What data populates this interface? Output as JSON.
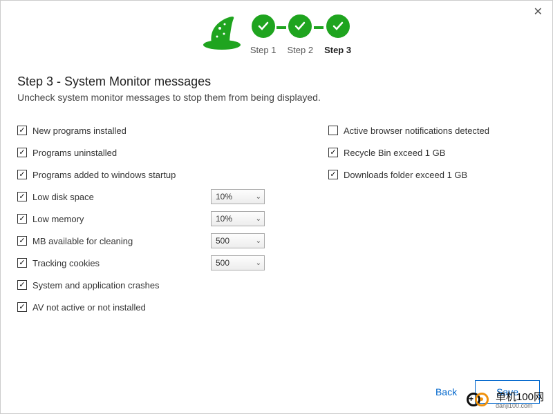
{
  "close_icon": "✕",
  "steps": {
    "s1": "Step 1",
    "s2": "Step 2",
    "s3": "Step 3"
  },
  "title": "Step 3 - System Monitor messages",
  "subtitle": "Uncheck system monitor messages to stop them from being displayed.",
  "left": {
    "new_programs": "New programs installed",
    "uninstalled": "Programs uninstalled",
    "startup": "Programs added to windows startup",
    "low_disk": "Low disk space",
    "low_disk_val": "10%",
    "low_mem": "Low memory",
    "low_mem_val": "10%",
    "mb_clean": "MB available for cleaning",
    "mb_clean_val": "500",
    "tracking": "Tracking cookies",
    "tracking_val": "500",
    "crashes": "System and application crashes",
    "av": "AV not active or not installed"
  },
  "right": {
    "browser_notif": "Active browser notifications detected",
    "recycle": "Recycle Bin exceed 1 GB",
    "downloads": "Downloads folder exceed 1 GB"
  },
  "footer": {
    "back": "Back",
    "save": "Save"
  },
  "watermark": {
    "text": "单机100网",
    "sub": "danji100.com"
  }
}
